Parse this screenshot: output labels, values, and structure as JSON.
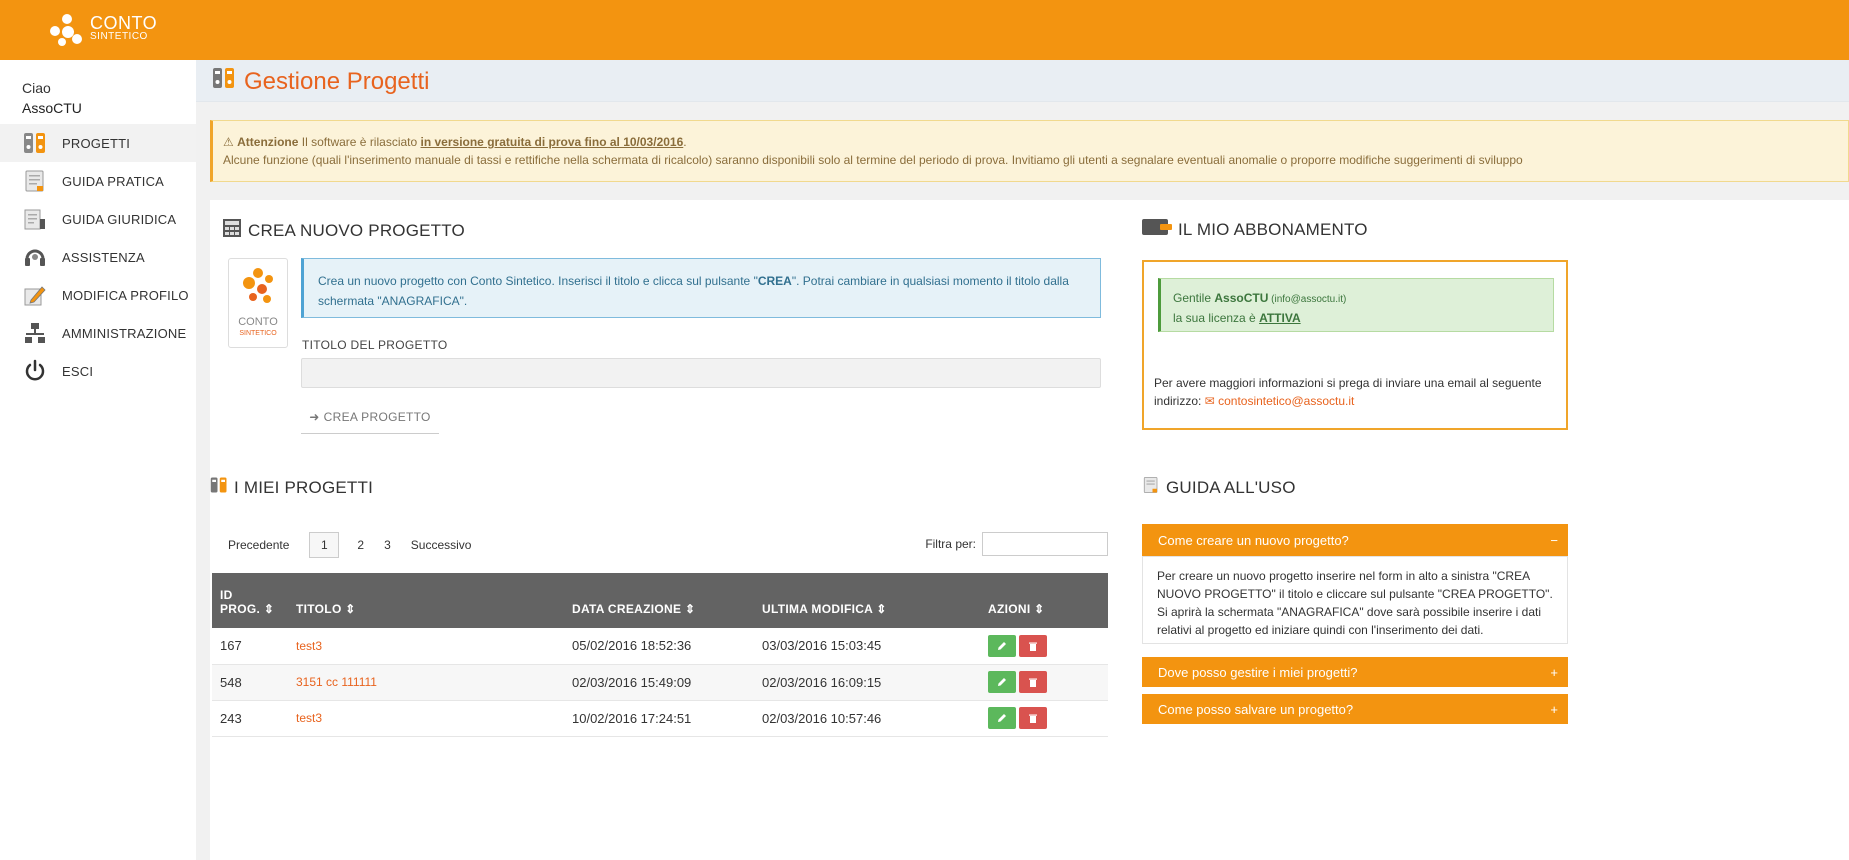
{
  "app": {
    "logo_line1": "CONTO",
    "logo_line2": "SINTETICO"
  },
  "sidebar": {
    "greeting": "Ciao",
    "user": "AssoCTU",
    "items": [
      {
        "label": "PROGETTI",
        "icon": "projects-icon"
      },
      {
        "label": "GUIDA PRATICA",
        "icon": "guide-icon"
      },
      {
        "label": "GUIDA GIURIDICA",
        "icon": "legal-guide-icon"
      },
      {
        "label": "ASSISTENZA",
        "icon": "support-icon"
      },
      {
        "label": "MODIFICA PROFILO",
        "icon": "edit-profile-icon"
      },
      {
        "label": "AMMINISTRAZIONE",
        "icon": "admin-icon"
      },
      {
        "label": "ESCI",
        "icon": "power-icon"
      }
    ]
  },
  "page": {
    "title": "Gestione Progetti"
  },
  "alert": {
    "strong": "Attenzione",
    "text1": " Il software è rilasciato ",
    "highlight": "in versione gratuita di prova fino al 10/03/2016",
    "text2": ".",
    "line2": "Alcune funzione (quali l'inserimento manuale di tassi e rettifiche nella schermata di ricalcolo) saranno disponibili solo al termine del periodo di prova. Invitiamo gli utenti a segnalare eventuali anomalie o proporre modifiche suggerimenti di sviluppo"
  },
  "create": {
    "title": "CREA NUOVO PROGETTO",
    "info_pre": "Crea un nuovo progetto con Conto Sintetico. Inserisci il titolo e clicca sul pulsante \"",
    "info_bold": "CREA",
    "info_post": "\". Potrai cambiare in qualsiasi momento il titolo dalla schermata \"ANAGRAFICA\".",
    "field_label": "TITOLO DEL PROGETTO",
    "field_value": "",
    "button": "CREA PROGETTO"
  },
  "projects": {
    "title": "I MIEI PROGETTI",
    "pager": {
      "prev": "Precedente",
      "pages": [
        "1",
        "2",
        "3"
      ],
      "current": "1",
      "next": "Successivo"
    },
    "filter_label": "Filtra per:",
    "filter_value": "",
    "columns": [
      "ID PROG.",
      "TITOLO",
      "DATA CREAZIONE",
      "ULTIMA MODIFICA",
      "AZIONI"
    ],
    "column_id_l1": "ID",
    "column_id_l2": "PROG.",
    "rows": [
      {
        "id": "167",
        "title": "test3",
        "created": "05/02/2016 18:52:36",
        "modified": "03/03/2016 15:03:45"
      },
      {
        "id": "548",
        "title": "3151 cc 111111",
        "created": "02/03/2016 15:49:09",
        "modified": "02/03/2016 16:09:15"
      },
      {
        "id": "243",
        "title": "test3",
        "created": "10/02/2016 17:24:51",
        "modified": "02/03/2016 10:57:46"
      }
    ]
  },
  "subscription": {
    "title": "IL MIO ABBONAMENTO",
    "gentile": "Gentile ",
    "user": "AssoCTU",
    "email_small": " (info@assoctu.it)",
    "license_pre": "la sua licenza è ",
    "license_status": "ATTIVA",
    "info": "Per avere maggiori informazioni si prega di inviare una email al seguente indirizzo: ",
    "contact_email": "contosintetico@assoctu.it"
  },
  "guide": {
    "title": "GUIDA ALL'USO",
    "items": [
      {
        "q": "Come creare un nuovo progetto?",
        "toggle": "−",
        "answer": "Per creare un nuovo progetto inserire nel form in alto a sinistra \"CREA NUOVO PROGETTO\" il titolo e cliccare sul pulsante \"CREA PROGETTO\". Si aprirà la schermata \"ANAGRAFICA\" dove sarà possibile inserire i dati relativi al progetto ed iniziare quindi con l'inserimento dei dati."
      },
      {
        "q": "Dove posso gestire i miei progetti?",
        "toggle": "+"
      },
      {
        "q": "Come posso salvare un progetto?",
        "toggle": "+"
      }
    ]
  },
  "colors": {
    "brand_orange": "#f39410",
    "title_orange": "#e8631e",
    "table_header": "#636363",
    "edit_green": "#5cb85c",
    "delete_red": "#d9534f"
  }
}
